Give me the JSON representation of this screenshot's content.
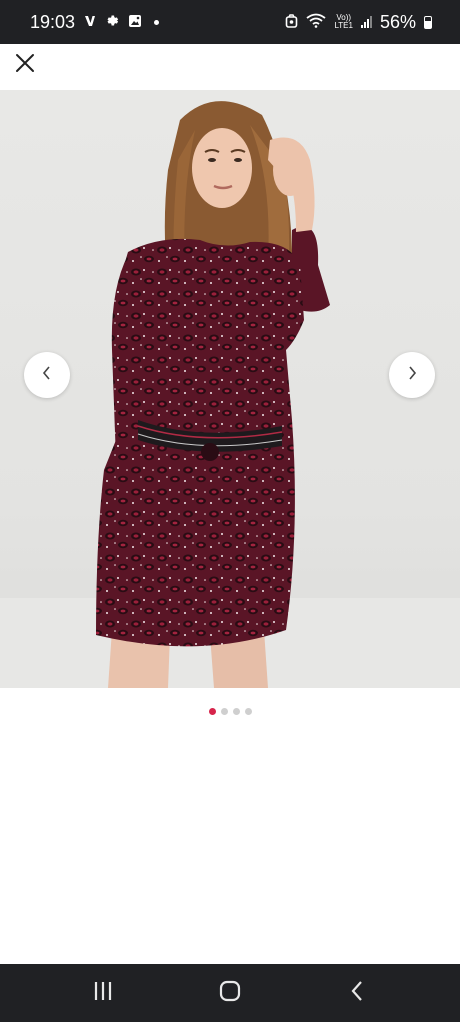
{
  "status_bar": {
    "time": "19:03",
    "left_icons": [
      "v-app-icon",
      "gear-icon",
      "image-icon",
      "notification-dot-icon"
    ],
    "right_icons": [
      "alarm-icon",
      "wifi-icon",
      "volte-icon",
      "signal-icon"
    ],
    "volte_line1": "Vo))",
    "volte_line2": "LTE1",
    "battery_percent": "56%",
    "battery_level": 0.56
  },
  "topbar": {
    "close_icon": "close-icon"
  },
  "gallery": {
    "image_description_icon": "product-photo",
    "prev_icon": "chevron-left-icon",
    "next_icon": "chevron-right-icon",
    "page_count": 4,
    "active_page": 1,
    "colors": {
      "active_dot": "#d6244b",
      "inactive_dot": "#cfcfcf",
      "dress": "#5a1526"
    }
  },
  "system_nav": {
    "recents_icon": "recents-icon",
    "home_icon": "home-icon",
    "back_icon": "back-icon"
  }
}
